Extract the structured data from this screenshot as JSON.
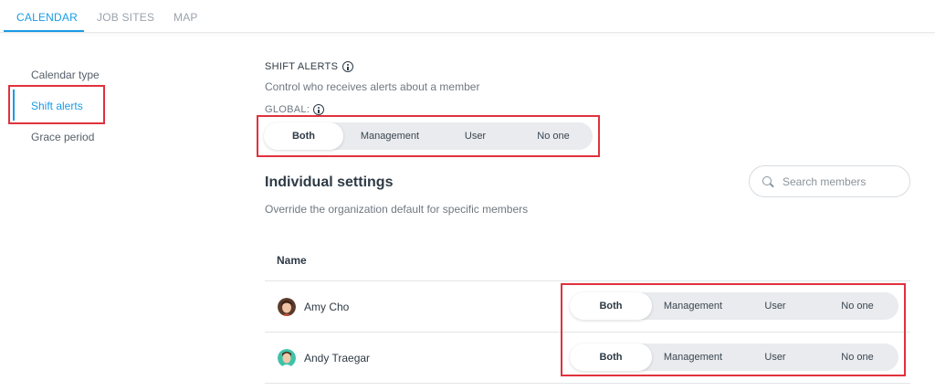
{
  "tabs": [
    {
      "label": "CALENDAR",
      "active": true
    },
    {
      "label": "JOB SITES",
      "active": false
    },
    {
      "label": "MAP",
      "active": false
    }
  ],
  "sidenav": {
    "items": [
      {
        "label": "Calendar type",
        "active": false
      },
      {
        "label": "Shift alerts",
        "active": true
      },
      {
        "label": "Grace period",
        "active": false
      }
    ]
  },
  "shift_alerts": {
    "title": "SHIFT ALERTS",
    "description": "Control who receives alerts about a member",
    "global_label": "GLOBAL:",
    "options": [
      "Both",
      "Management",
      "User",
      "No one"
    ],
    "selected": "Both"
  },
  "individual": {
    "title": "Individual settings",
    "description": "Override the organization default for specific members",
    "search_placeholder": "Search members",
    "column_name": "Name",
    "members": [
      {
        "name": "Amy Cho",
        "selected": "Both"
      },
      {
        "name": "Andy Traegar",
        "selected": "Both"
      }
    ]
  },
  "colors": {
    "accent": "#1a9be6",
    "highlight_box": "#e0323c"
  }
}
